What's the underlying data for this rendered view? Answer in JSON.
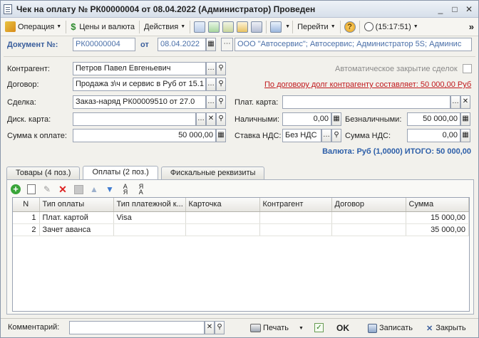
{
  "window": {
    "title": "Чек на оплату № РК00000004 от 08.04.2022 (Администратор) Проведен"
  },
  "toolbar": {
    "operation": "Операция",
    "prices": "Цены и валюта",
    "actions": "Действия",
    "goto": "Перейти",
    "time": "(15:17:51)",
    "more": "»"
  },
  "header": {
    "doc_label": "Документ №:",
    "doc_number": "РК00000004",
    "from_label": "от",
    "date": "08.04.2022",
    "org": "ООО \"Автосервис\"; Автосервис; Администратор 5S; Админис"
  },
  "form": {
    "counterparty_label": "Контрагент:",
    "counterparty": "Петров Павел Евгеньевич",
    "autoclose_label": "Автоматическое закрытие сделок",
    "contract_label": "Договор:",
    "contract": "Продажа з\\ч и сервис в Руб от 15.1",
    "debt_link": "По договору долг контрагенту составляет: 50 000,00 Руб",
    "deal_label": "Сделка:",
    "deal": "Заказ-наряд РК00009510 от 27.0",
    "paycard_label": "Плат. карта:",
    "paycard": "",
    "disccard_label": "Диск. карта:",
    "disccard": "",
    "cash_label": "Наличными:",
    "cash": "0,00",
    "noncash_label": "Безналичными:",
    "noncash": "50 000,00",
    "sum_label": "Сумма к оплате:",
    "sum": "50 000,00",
    "vat_rate_label": "Ставка НДС:",
    "vat_rate": "Без НДС",
    "vat_sum_label": "Сумма НДС:",
    "vat_sum": "0,00",
    "total": "Валюта: Руб (1,0000) ИТОГО: 50 000,00"
  },
  "tabs": [
    {
      "label": "Товары (4 поз.)"
    },
    {
      "label": "Оплаты (2 поз.)"
    },
    {
      "label": "Фискальные реквизиты"
    }
  ],
  "table": {
    "columns": [
      "N",
      "Тип оплаты",
      "Тип платежной к...",
      "Карточка",
      "Контрагент",
      "Договор",
      "Сумма"
    ],
    "rows": [
      [
        "1",
        "Плат. картой",
        "Visa",
        "",
        "",
        "",
        "15 000,00"
      ],
      [
        "2",
        "Зачет аванса",
        "",
        "",
        "",
        "",
        "35 000,00"
      ]
    ]
  },
  "bottom": {
    "comment_label": "Комментарий:",
    "comment": "",
    "print": "Печать",
    "ok": "OK",
    "save": "Записать",
    "close": "Закрыть"
  }
}
